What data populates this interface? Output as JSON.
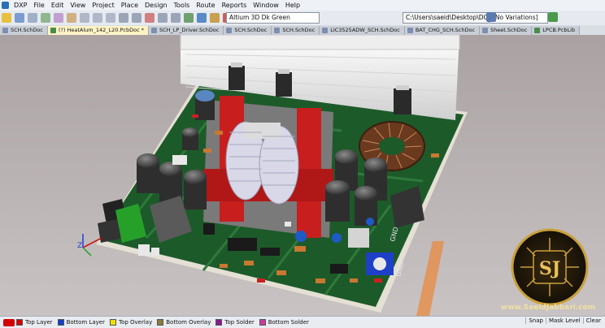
{
  "menu": [
    "DXP",
    "File",
    "Edit",
    "View",
    "Project",
    "Place",
    "Design",
    "Tools",
    "Route",
    "Reports",
    "Window",
    "Help"
  ],
  "toolbar": {
    "view_config": "Altium 3D Dk Green",
    "path": "C:\\Users\\saeid\\Desktop\\DC-DC Pr",
    "variations": "[No Variations]"
  },
  "tabs": [
    {
      "label": "SCH.SchDoc",
      "active": false
    },
    {
      "label": "(?) HeatAlum_142_L20.PcbDoc *",
      "active": true
    },
    {
      "label": "SCH_LP_Driver.SchDoc",
      "active": false
    },
    {
      "label": "SCH.SchDoc",
      "active": false
    },
    {
      "label": "SCH.SchDoc",
      "active": false
    },
    {
      "label": "LIC3525ADW_SCH.SchDoc",
      "active": false
    },
    {
      "label": "BAT_CHG_SCH.SchDoc",
      "active": false
    },
    {
      "label": "Sheet.SchDoc",
      "active": false
    },
    {
      "label": "LPCB.PcbLib",
      "active": false
    }
  ],
  "pcb": {
    "silk_gnd1": "GND",
    "silk_gnd2": "GND",
    "axis_z": "Z",
    "watermark": "www.SaeidJabbari.com",
    "logo_letters": "SJ"
  },
  "layers": [
    {
      "label": "Top Layer",
      "color": "#d40000"
    },
    {
      "label": "Bottom Layer",
      "color": "#1240c8"
    },
    {
      "label": "Top Overlay",
      "color": "#f0e000"
    },
    {
      "label": "Bottom Overlay",
      "color": "#8c7a3a"
    },
    {
      "label": "Top Solder",
      "color": "#8a1a8a"
    },
    {
      "label": "Bottom Solder",
      "color": "#c83c9c"
    }
  ],
  "status": {
    "snap": "Snap",
    "mask_level": "Mask Level",
    "clear": "Clear"
  },
  "colors": {
    "board": "#1d5a2a",
    "heatsink": "#eeeeee",
    "transformer_bobbin": "#c81e1e",
    "winding": "#d8d8e8",
    "toroid": "#6a3a1e"
  }
}
